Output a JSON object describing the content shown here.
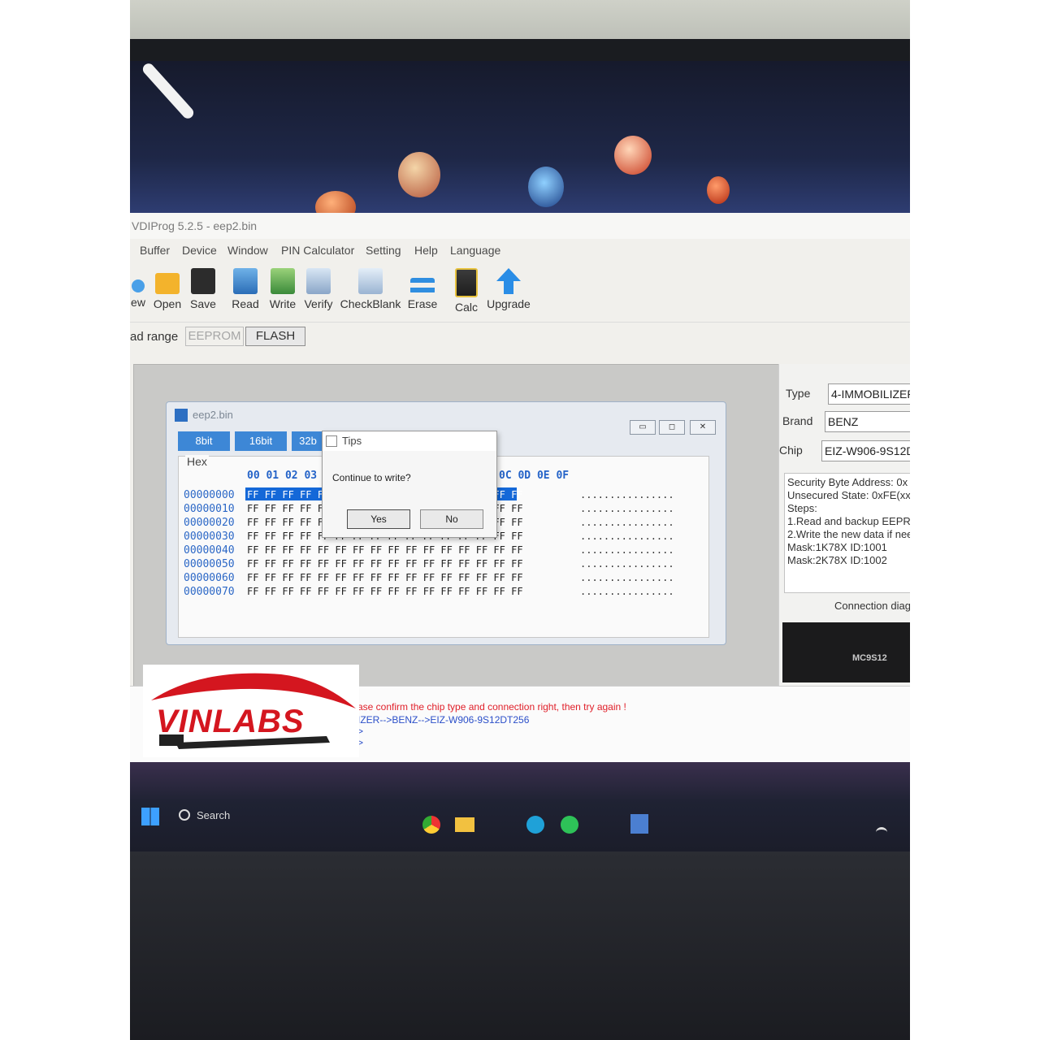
{
  "window": {
    "title": "VDIProg 5.2.5 - eep2.bin"
  },
  "menu": [
    "Buffer",
    "Device",
    "Window",
    "PIN Calculator",
    "Setting",
    "Help",
    "Language"
  ],
  "toolbar": {
    "new": "ew",
    "open": "Open",
    "save": "Save",
    "read": "Read",
    "write": "Write",
    "verify": "Verify",
    "checkblank": "CheckBlank",
    "erase": "Erase",
    "calc": "Calc",
    "upgrade": "Upgrade"
  },
  "range": {
    "label": "ad range",
    "eeprom": "EEPROM",
    "flash": "FLASH"
  },
  "hexwindow": {
    "title": "eep2.bin",
    "tabs": [
      "8bit",
      "16bit",
      "32b"
    ],
    "group_label": "Hex",
    "columns_left": "00 01 02 03",
    "columns_right": "0C 0D 0E 0F",
    "addresses": [
      "00000000",
      "00000010",
      "00000020",
      "00000030",
      "00000040",
      "00000050",
      "00000060",
      "00000070"
    ],
    "row_bytes": "FF FF FF FF FF FF FF FF FF FF FF FF FF FF FF FF",
    "ascii": "................",
    "min_btn": "▭",
    "max_btn": "◻",
    "close_btn": "✕"
  },
  "dialog": {
    "title": "Tips",
    "message": "Continue to write?",
    "yes": "Yes",
    "no": "No"
  },
  "device": {
    "type_label": "Type",
    "type_value": "4-IMMOBILIZER",
    "brand_label": "Brand",
    "brand_value": "BENZ",
    "chip_label": "Chip",
    "chip_value": "EIZ-W906-9S12D",
    "info_lines": [
      "Security Byte Address: 0x",
      "Unsecured State: 0xFE(xx",
      "Steps:",
      "1.Read and backup EEPRO",
      "2.Write the new data if need",
      "Mask:1K78X ID:1001",
      "Mask:2K78X ID:1002"
    ],
    "connection": "Connection diag",
    "chip_print": "MC9S12"
  },
  "log": {
    "line1": "ase confirm the chip type and connection right, then try again !",
    "line2": "IZER-->BENZ-->EIZ-W906-9S12DT256",
    "line3": ">",
    "line4": ">"
  },
  "watermark": {
    "text": "VINLABS"
  },
  "taskbar": {
    "search": "Search"
  },
  "colors": {
    "accent_blue": "#3d87d6",
    "selection": "#1468d8",
    "log_red": "#e0202a",
    "log_blue": "#2b4fc9",
    "logo_red": "#d4161f"
  }
}
